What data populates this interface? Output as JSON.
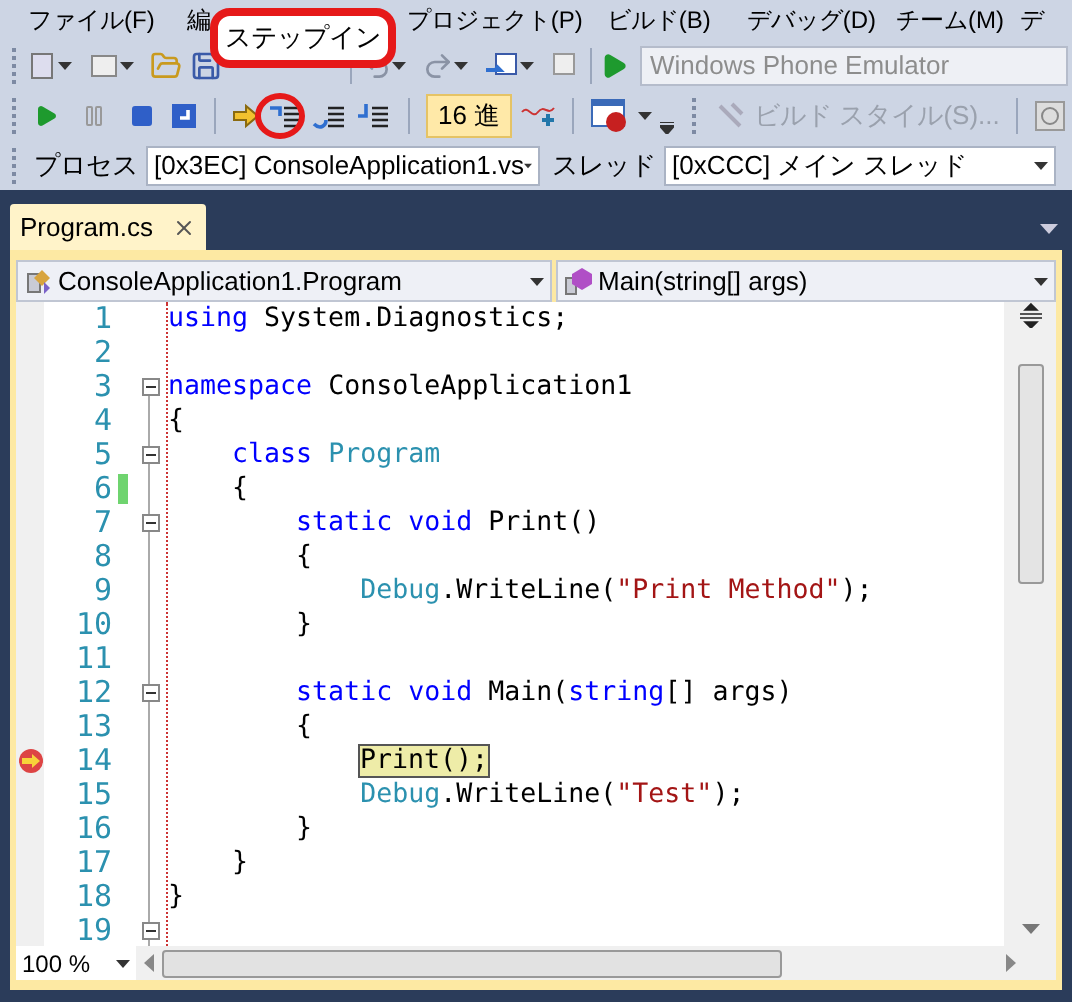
{
  "menu": [
    {
      "label": "ファイル(F)"
    },
    {
      "label": "編"
    },
    {
      "label": "プロジェクト(P)"
    },
    {
      "label": "ビルド(B)"
    },
    {
      "label": "デバッグ(D)"
    },
    {
      "label": "チーム(M)"
    },
    {
      "label": "デ"
    }
  ],
  "tooltip": {
    "text": "ステップイン"
  },
  "emulator": {
    "value": "Windows Phone Emulator"
  },
  "hex_button": {
    "label": "16 進",
    "selected": true
  },
  "build_style": {
    "label": "ビルド スタイル(S)...",
    "disabled": true
  },
  "process": {
    "label": "プロセス",
    "value": "[0x3EC] ConsoleApplication1.vs"
  },
  "thread": {
    "label": "スレッド",
    "value": "[0xCCC] メイン スレッド"
  },
  "tabs": [
    {
      "label": "Program.cs",
      "selected": true
    }
  ],
  "type_dropdown": {
    "value": "ConsoleApplication1.Program"
  },
  "member_dropdown": {
    "value": "Main(string[] args)"
  },
  "lines": [
    {
      "number": "1",
      "fold": false,
      "changed": false,
      "current": false,
      "segments": [
        {
          "kind": "keyword",
          "text": "using"
        },
        {
          "kind": "plain",
          "text": " System.Diagnostics;"
        }
      ]
    },
    {
      "number": "2",
      "fold": false,
      "changed": false,
      "current": false
    },
    {
      "number": "3",
      "fold": true,
      "changed": false,
      "current": false,
      "segments": [
        {
          "kind": "keyword",
          "text": "namespace"
        },
        {
          "kind": "plain",
          "text": " ConsoleApplication1"
        }
      ]
    },
    {
      "number": "4",
      "fold": false,
      "changed": false,
      "current": false,
      "segments": [
        {
          "kind": "plain",
          "text": "{"
        }
      ]
    },
    {
      "number": "5",
      "fold": true,
      "changed": false,
      "current": false,
      "segments": [
        {
          "kind": "keyword",
          "text": "    class "
        },
        {
          "kind": "type",
          "text": "Program"
        }
      ]
    },
    {
      "number": "6",
      "fold": false,
      "changed": true,
      "current": false,
      "segments": [
        {
          "kind": "plain",
          "text": "    {"
        }
      ]
    },
    {
      "number": "7",
      "fold": true,
      "changed": false,
      "current": false,
      "segments": [
        {
          "kind": "keyword",
          "text": "        static void"
        },
        {
          "kind": "plain",
          "text": " Print()"
        }
      ]
    },
    {
      "number": "8",
      "fold": false,
      "changed": false,
      "current": false,
      "segments": [
        {
          "kind": "plain",
          "text": "        {"
        }
      ]
    },
    {
      "number": "9",
      "fold": false,
      "changed": false,
      "current": false,
      "segments": [
        {
          "kind": "type",
          "text": "            Debug"
        },
        {
          "kind": "plain",
          "text": ".WriteLine("
        },
        {
          "kind": "string",
          "text": "\"Print Method\""
        },
        {
          "kind": "plain",
          "text": ");"
        }
      ]
    },
    {
      "number": "10",
      "fold": false,
      "changed": false,
      "current": false,
      "segments": [
        {
          "kind": "plain",
          "text": "        }"
        }
      ]
    },
    {
      "number": "11",
      "fold": false,
      "changed": false,
      "current": false
    },
    {
      "number": "12",
      "fold": true,
      "changed": false,
      "current": false,
      "segments": [
        {
          "kind": "keyword",
          "text": "        static void"
        },
        {
          "kind": "plain",
          "text": " Main("
        },
        {
          "kind": "keyword",
          "text": "string"
        },
        {
          "kind": "plain",
          "text": "[] args)"
        }
      ]
    },
    {
      "number": "13",
      "fold": false,
      "changed": false,
      "current": false,
      "segments": [
        {
          "kind": "plain",
          "text": "        {"
        }
      ]
    },
    {
      "number": "14",
      "fold": false,
      "changed": false,
      "current": true,
      "segments": [
        {
          "kind": "highlight",
          "text": "Print();"
        }
      ]
    },
    {
      "number": "15",
      "fold": false,
      "changed": false,
      "current": false,
      "segments": [
        {
          "kind": "type",
          "text": "            Debug"
        },
        {
          "kind": "plain",
          "text": ".WriteLine("
        },
        {
          "kind": "string",
          "text": "\"Test\""
        },
        {
          "kind": "plain",
          "text": ");"
        }
      ]
    },
    {
      "number": "16",
      "fold": false,
      "changed": false,
      "current": false,
      "segments": [
        {
          "kind": "plain",
          "text": "        }"
        }
      ]
    },
    {
      "number": "17",
      "fold": false,
      "changed": false,
      "current": false,
      "segments": [
        {
          "kind": "plain",
          "text": "    }"
        }
      ]
    },
    {
      "number": "18",
      "fold": false,
      "changed": false,
      "current": false,
      "segments": [
        {
          "kind": "plain",
          "text": "}"
        }
      ]
    },
    {
      "number": "19",
      "fold": true,
      "changed": false,
      "current": false
    }
  ],
  "zoom": {
    "value": "100 %"
  }
}
